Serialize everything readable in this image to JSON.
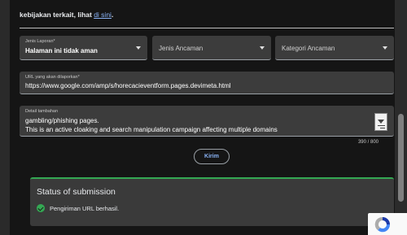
{
  "intro": {
    "text": "kebijakan terkait, lihat",
    "link": "di sini",
    "suffix": "."
  },
  "form": {
    "report_type": {
      "label": "Jenis Laporan*",
      "value": "Halaman ini tidak aman"
    },
    "threat_type": {
      "placeholder": "Jenis Ancaman"
    },
    "threat_category": {
      "placeholder": "Kategori Ancaman"
    },
    "url": {
      "label": "URL yang akan dilaporkan*",
      "value": "https://www.google.com/amp/s/horecacieventform.pages.devimeta.html"
    },
    "details": {
      "label": "Detail tambahan",
      "line1": "gambling/phishing pages.",
      "line2": "This is an active cloaking and search manipulation campaign affecting multiple domains"
    },
    "counter": "390 / 800",
    "submit_label": "Kirim"
  },
  "status": {
    "title": "Status of submission",
    "message": "Pengiriman URL berhasil."
  },
  "colors": {
    "accent": "#8ab4f8",
    "success": "#34a853",
    "background": "#151515"
  },
  "icons": {
    "success": "check-circle-icon",
    "captcha": "recaptcha-icon"
  }
}
